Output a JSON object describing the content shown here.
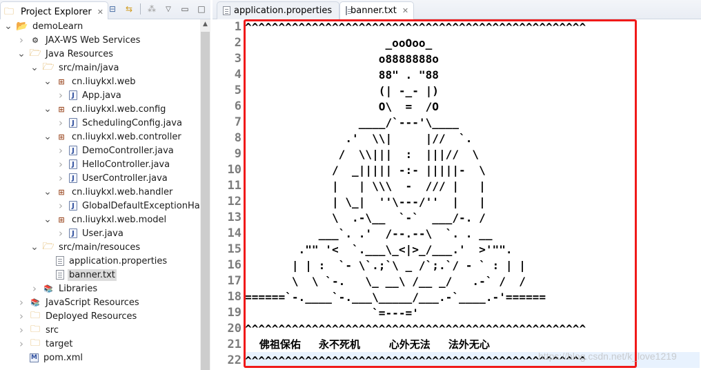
{
  "explorer": {
    "title": "Project Explorer",
    "close_glyph": "✕",
    "tools": [
      "collapse-all-icon",
      "link-with-editor-icon",
      "filter-icon",
      "view-menu-icon",
      "minimize-icon",
      "maximize-icon"
    ],
    "tree": [
      {
        "label": "demoLearn",
        "depth": 0,
        "state": "open",
        "icon": "project"
      },
      {
        "label": "JAX-WS Web Services",
        "depth": 1,
        "state": "closed",
        "icon": "webservice"
      },
      {
        "label": "Java Resources",
        "depth": 1,
        "state": "open",
        "icon": "java-resources"
      },
      {
        "label": "src/main/java",
        "depth": 2,
        "state": "open",
        "icon": "source-folder"
      },
      {
        "label": "cn.liuykxl.web",
        "depth": 3,
        "state": "open",
        "icon": "package"
      },
      {
        "label": "App.java",
        "depth": 4,
        "state": "closed",
        "icon": "java"
      },
      {
        "label": "cn.liuykxl.web.config",
        "depth": 3,
        "state": "open",
        "icon": "package"
      },
      {
        "label": "SchedulingConfig.java",
        "depth": 4,
        "state": "closed",
        "icon": "java"
      },
      {
        "label": "cn.liuykxl.web.controller",
        "depth": 3,
        "state": "open",
        "icon": "package"
      },
      {
        "label": "DemoController.java",
        "depth": 4,
        "state": "closed",
        "icon": "java"
      },
      {
        "label": "HelloController.java",
        "depth": 4,
        "state": "closed",
        "icon": "java"
      },
      {
        "label": "UserController.java",
        "depth": 4,
        "state": "closed",
        "icon": "java"
      },
      {
        "label": "cn.liuykxl.web.handler",
        "depth": 3,
        "state": "open",
        "icon": "package"
      },
      {
        "label": "GlobalDefaultExceptionHandl",
        "depth": 4,
        "state": "closed",
        "icon": "java"
      },
      {
        "label": "cn.liuykxl.web.model",
        "depth": 3,
        "state": "open",
        "icon": "package"
      },
      {
        "label": "User.java",
        "depth": 4,
        "state": "closed",
        "icon": "java"
      },
      {
        "label": "src/main/resouces",
        "depth": 2,
        "state": "open",
        "icon": "source-folder"
      },
      {
        "label": "application.properties",
        "depth": 3,
        "state": "none",
        "icon": "file"
      },
      {
        "label": "banner.txt",
        "depth": 3,
        "state": "none",
        "icon": "file",
        "selected": true
      },
      {
        "label": "Libraries",
        "depth": 2,
        "state": "closed",
        "icon": "library"
      },
      {
        "label": "JavaScript Resources",
        "depth": 1,
        "state": "closed",
        "icon": "library"
      },
      {
        "label": "Deployed Resources",
        "depth": 1,
        "state": "closed",
        "icon": "deployed"
      },
      {
        "label": "src",
        "depth": 1,
        "state": "closed",
        "icon": "folder"
      },
      {
        "label": "target",
        "depth": 1,
        "state": "closed",
        "icon": "folder"
      },
      {
        "label": "pom.xml",
        "depth": 1,
        "state": "none",
        "icon": "xml"
      }
    ]
  },
  "editor": {
    "tabs": [
      {
        "label": "application.properties",
        "active": false
      },
      {
        "label": "banner.txt",
        "active": true,
        "close_glyph": "✕"
      }
    ],
    "current_line": 22,
    "lines": [
      "^^^^^^^^^^^^^^^^^^^^^^^^^^^^^^^^^^^^^^^^^^^^^^^^^^^",
      "                     _ooOoo_",
      "                    o8888888o",
      "                    88\" . \"88",
      "                    (| -_- |)",
      "                    O\\  =  /O",
      "                 ____/`---'\\____",
      "               .'  \\\\|     |//  `.",
      "              /  \\\\|||  :  |||//  \\",
      "             /  _||||| -:- |||||-  \\",
      "             |   | \\\\\\  -  /// |   |",
      "             | \\_|  ''\\---/''  |   |",
      "             \\  .-\\__  `-`  ___/-. /",
      "           ___`. .'  /--.--\\  `. . __",
      "        .\"\" '<  `.___\\_<|>_/___.'  >'\"\".",
      "       | | :  `- \\`.;`\\ _ /`;.`/ - ` : | |",
      "       \\  \\ `-.   \\_ __\\ /__ _/   .-` /  /",
      "======`-.____`-.___\\_____/___.-`____.-'======",
      "                   `=---='",
      "^^^^^^^^^^^^^^^^^^^^^^^^^^^^^^^^^^^^^^^^^^^^^^^^^^^",
      "    佛祖保佑     永不死机        心外无法     法外无心",
      "^^^^^^^^^^^^^^^^^^^^^^^^^^^^^^^^^^^^^^^^^^^^^^^^^^^"
    ],
    "line_numbers": [
      "1",
      "2",
      "3",
      "4",
      "5",
      "6",
      "7",
      "8",
      "9",
      "10",
      "11",
      "12",
      "13",
      "14",
      "15",
      "16",
      "17",
      "18",
      "19",
      "20",
      "21",
      "22"
    ]
  },
  "annotation": {
    "color": "#f01919"
  },
  "watermark": "https://blog.csdn.net/k_love1219"
}
